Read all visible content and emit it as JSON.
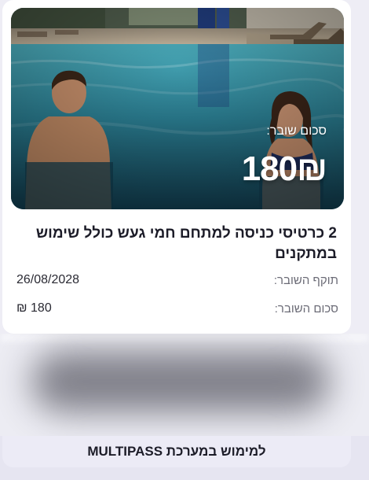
{
  "voucher": {
    "hero_label": "סכום שובר:",
    "hero_amount": "180₪",
    "title": "2 כרטיסי כניסה למתחם חמי געש כולל שימוש במתקנים",
    "details": [
      {
        "label": "תוקף השובר:",
        "value": "26/08/2028"
      },
      {
        "label": "סכום השובר:",
        "value": "180 ₪"
      }
    ]
  },
  "footer": {
    "cta_label": "למימוש במערכת MULTIPASS"
  },
  "colors": {
    "background": "#eeedf5",
    "card": "#ffffff",
    "pool_water": "#2c8a9e",
    "title_text": "#1c1c28",
    "muted_text": "#6b6b76"
  },
  "icons": {
    "hero": "pool-photo"
  }
}
